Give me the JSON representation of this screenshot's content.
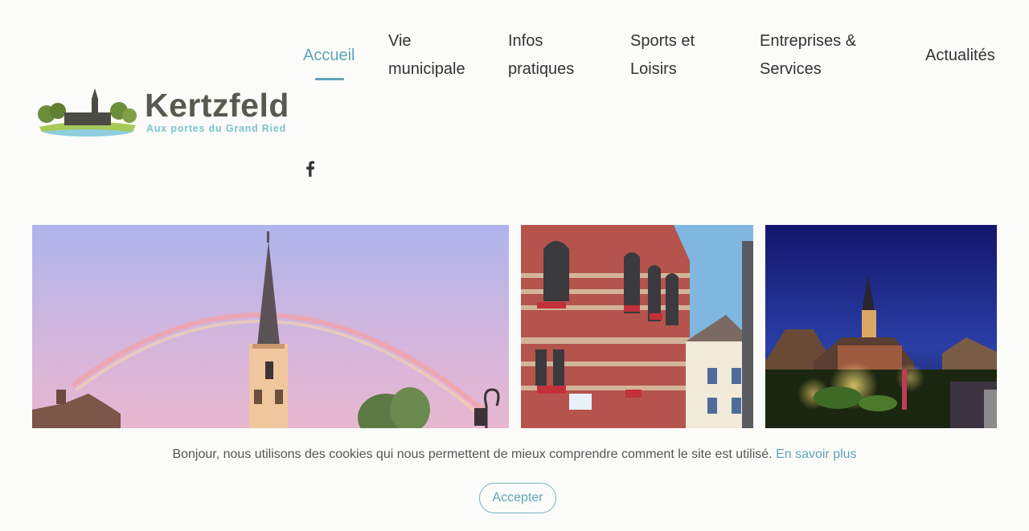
{
  "site": {
    "logo_title": "Kertzfeld",
    "logo_subtitle": "Aux portes du Grand Ried"
  },
  "nav": {
    "items": [
      {
        "label": "Accueil",
        "active": true
      },
      {
        "label": "Vie municipale"
      },
      {
        "label": "Infos pratiques"
      },
      {
        "label": "Sports et Loisirs"
      },
      {
        "label": "Entreprises & Services"
      },
      {
        "label": "Actualités"
      }
    ]
  },
  "social": {
    "facebook_icon": "facebook-icon"
  },
  "colors": {
    "accent": "#5ea5b8",
    "background": "#fbfbf9",
    "text": "#333333"
  },
  "cookie": {
    "message": "Bonjour, nous utilisons des cookies qui nous permettent de mieux comprendre comment le site est utilisé.",
    "link": "En savoir plus",
    "accept": "Accepter"
  }
}
